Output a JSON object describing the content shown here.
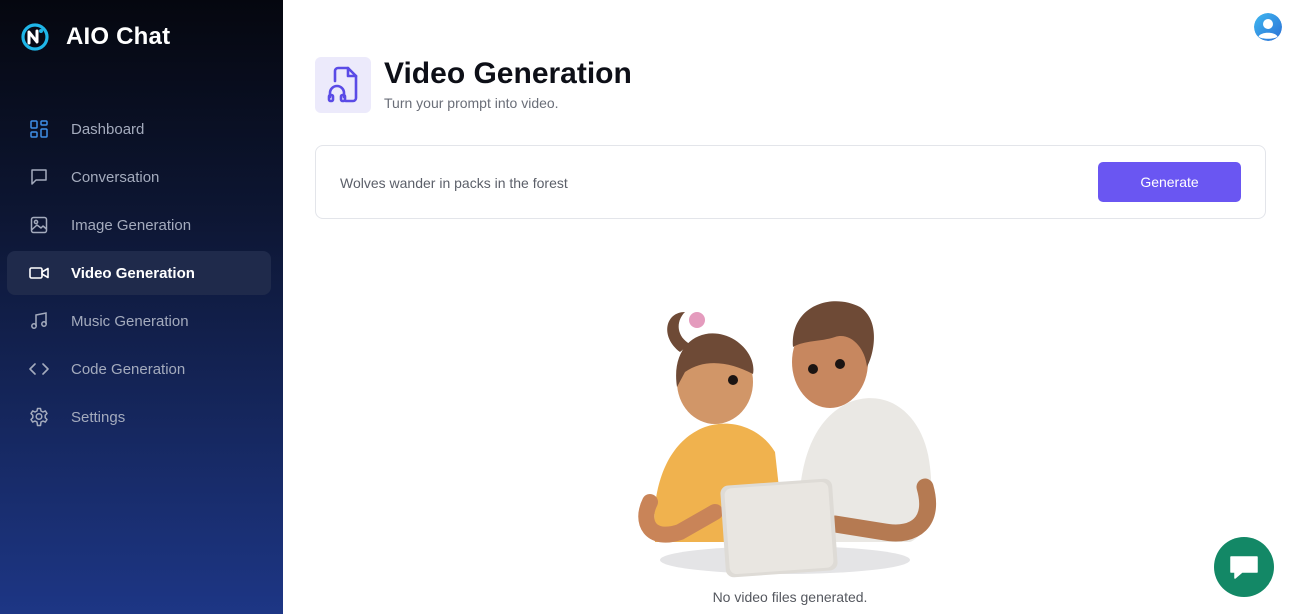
{
  "app": {
    "name": "AIO Chat"
  },
  "sidebar": {
    "items": [
      {
        "label": "Dashboard",
        "icon": "dashboard-icon",
        "active": false
      },
      {
        "label": "Conversation",
        "icon": "chat-bubble-icon",
        "active": false
      },
      {
        "label": "Image Generation",
        "icon": "image-icon",
        "active": false
      },
      {
        "label": "Video Generation",
        "icon": "video-camera-icon",
        "active": true
      },
      {
        "label": "Music Generation",
        "icon": "music-note-icon",
        "active": false
      },
      {
        "label": "Code Generation",
        "icon": "code-brackets-icon",
        "active": false
      },
      {
        "label": "Settings",
        "icon": "gear-icon",
        "active": false
      }
    ]
  },
  "header": {
    "title": "Video Generation",
    "subtitle": "Turn your prompt into video.",
    "icon": "video-file-icon"
  },
  "prompt": {
    "value": "Wolves wander in packs in the forest",
    "button_label": "Generate"
  },
  "empty_state": {
    "message": "No video files generated."
  },
  "colors": {
    "accent": "#6a56f2",
    "active_nav": "#1f2a4b",
    "chat_fab": "#138866",
    "brand_logo": "#1fb6e8"
  }
}
